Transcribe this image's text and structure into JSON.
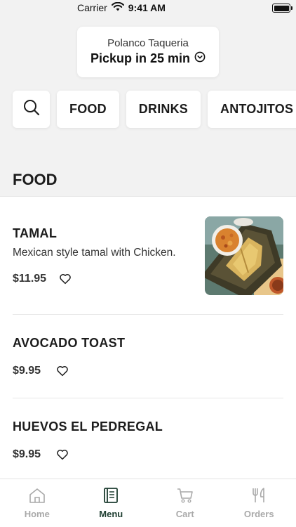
{
  "status_bar": {
    "carrier": "Carrier",
    "time": "9:41 AM"
  },
  "location": {
    "name": "Polanco Taqueria",
    "pickup": "Pickup in 25 min"
  },
  "categories": [
    "FOOD",
    "DRINKS",
    "ANTOJITOS"
  ],
  "section_title": "FOOD",
  "menu_items": [
    {
      "name": "TAMAL",
      "description": "Mexican style tamal with Chicken.",
      "price": "$11.95"
    },
    {
      "name": "AVOCADO TOAST",
      "price": "$9.95"
    },
    {
      "name": "HUEVOS EL PEDREGAL",
      "price": "$9.95"
    }
  ],
  "tabs": [
    {
      "label": "Home",
      "icon": "house-icon"
    },
    {
      "label": "Menu",
      "icon": "menu-book-icon",
      "active": true
    },
    {
      "label": "Cart",
      "icon": "cart-icon"
    },
    {
      "label": "Orders",
      "icon": "utensils-icon"
    }
  ],
  "colors": {
    "accent": "#1d3d30",
    "inactive_tab": "#a9a9a9",
    "background": "#f2f2f2"
  }
}
